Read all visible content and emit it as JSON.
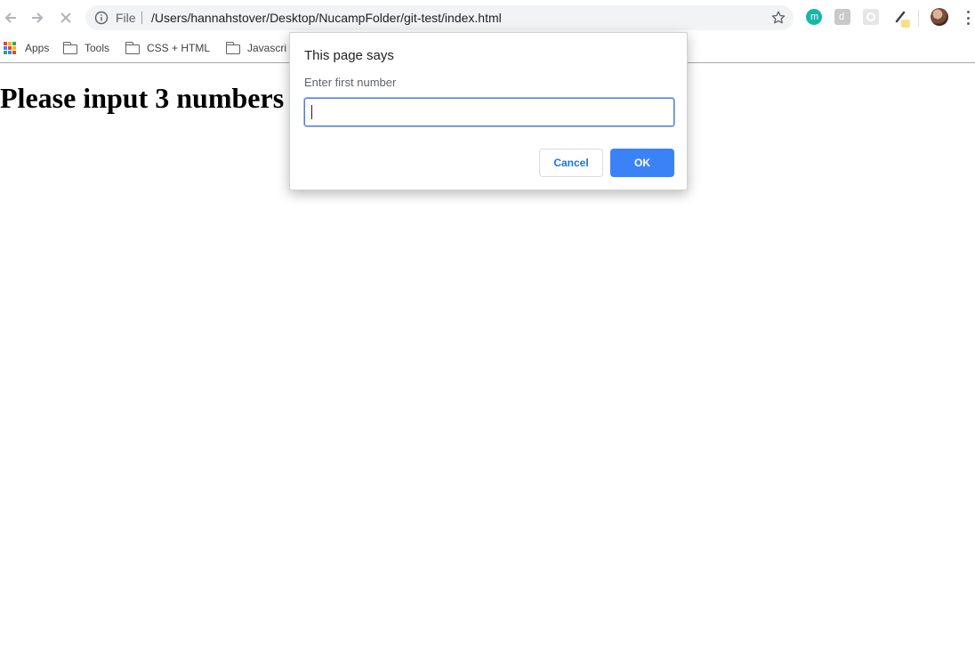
{
  "browser": {
    "scheme_label": "File",
    "url": "/Users/hannahstover/Desktop/NucampFolder/git-test/index.html",
    "extensions": [
      {
        "name": "m",
        "color": "#19b6a7"
      },
      {
        "name": "d",
        "color": "#bdbdbd"
      },
      {
        "name": "gear",
        "color": "#d8d8d8"
      },
      {
        "name": "pen",
        "color": "#3c4043"
      }
    ]
  },
  "bookmarks": {
    "items": [
      {
        "label": "Apps",
        "icon": "apps-grid-icon"
      },
      {
        "label": "Tools",
        "icon": "folder-icon"
      },
      {
        "label": "CSS + HTML",
        "icon": "folder-icon"
      },
      {
        "label": "Javascri",
        "icon": "folder-icon"
      }
    ]
  },
  "page": {
    "heading": "Please input 3 numbers"
  },
  "dialog": {
    "title": "This page says",
    "message": "Enter first number",
    "input_value": "",
    "cancel_label": "Cancel",
    "ok_label": "OK"
  },
  "colors": {
    "accent": "#3b82f6",
    "link_blue": "#1a73e8",
    "omnibox_bg": "#f1f3f4"
  }
}
